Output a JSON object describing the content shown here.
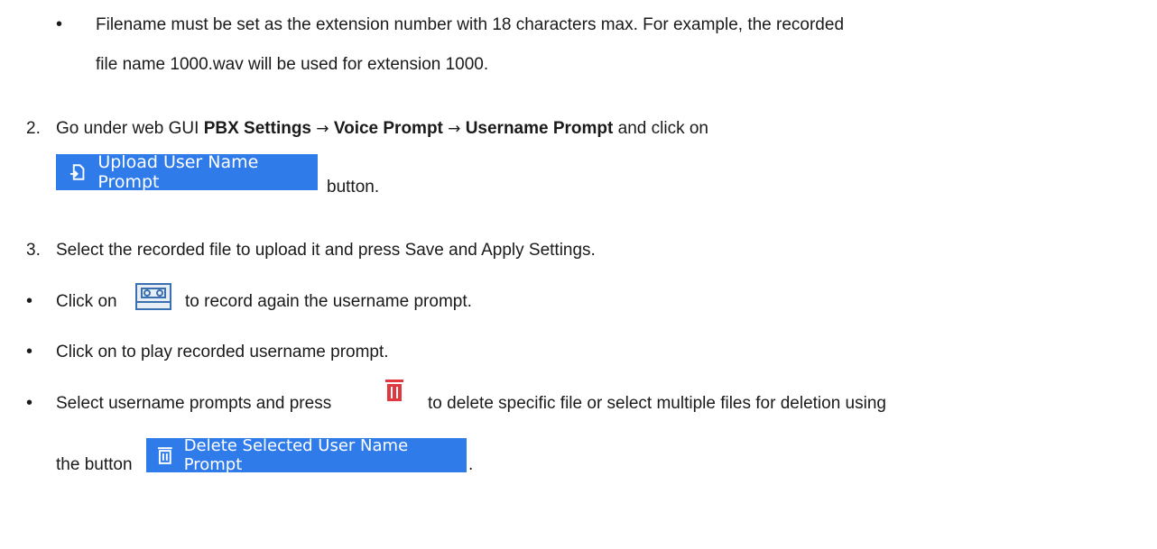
{
  "doc": {
    "bullet_char": "•",
    "item1": {
      "line1": "Filename must be set as the extension number with 18 characters max. For example, the recorded",
      "line2": "file name 1000.wav will be used for extension 1000."
    },
    "step2": {
      "num": "2.",
      "pre": "Go under web GUI ",
      "b1": "PBX Settings",
      "arrow1": "→",
      "b2": "Voice Prompt",
      "arrow2": "→",
      "b3": "Username Prompt",
      "post": " and click on",
      "after_button": "button."
    },
    "upload_button": {
      "label": "Upload User Name Prompt",
      "icon": "upload-file-icon"
    },
    "step3": {
      "num": "3.",
      "text": "Select the recorded file to upload it and press Save and Apply Settings."
    },
    "bullet_record": {
      "pre": "Click on",
      "post": "to record again the username prompt.",
      "icon": "cassette-icon"
    },
    "bullet_play": {
      "text": "Click on to play recorded username prompt."
    },
    "bullet_delete": {
      "pre": "Select username prompts and press",
      "post": "to delete specific file or select multiple files for deletion using",
      "icon": "trash-icon"
    },
    "bullet_delete_line2": {
      "pre": "the button",
      "post": "."
    },
    "delete_button": {
      "label": "Delete Selected User Name Prompt",
      "icon": "trash-icon"
    },
    "colors": {
      "button_blue": "#2f7bea",
      "trash_red": "#e0383e"
    }
  }
}
